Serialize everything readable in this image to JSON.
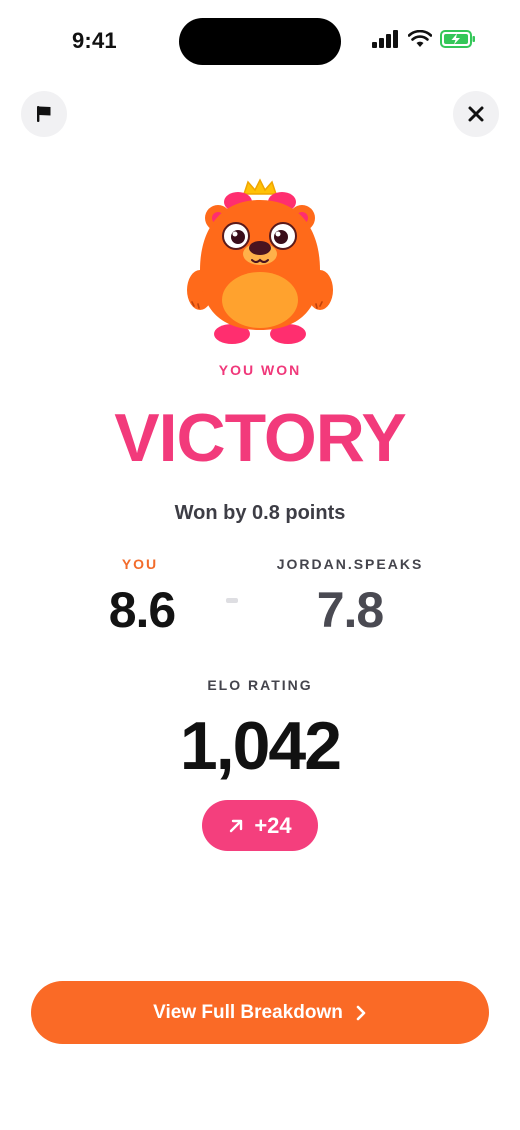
{
  "status_bar": {
    "time": "9:41",
    "icons": [
      "cellular-signal-icon",
      "wifi-icon",
      "battery-charging-icon"
    ],
    "battery_color": "#34c759"
  },
  "header": {
    "left_icon": "flag-icon",
    "right_icon": "close-icon"
  },
  "result": {
    "eyebrow": "YOU WON",
    "headline": "VICTORY",
    "margin_text": "Won by 0.8 points"
  },
  "scores": {
    "you_label": "YOU",
    "you_score": "8.6",
    "opponent_label": "JORDAN.SPEAKS",
    "opponent_score": "7.8"
  },
  "elo": {
    "label": "ELO RATING",
    "value": "1,042",
    "change": "+24",
    "change_icon": "arrow-up-right-icon"
  },
  "cta": {
    "label": "View Full Breakdown",
    "icon": "chevron-right-icon"
  },
  "colors": {
    "accent_pink": "#f23a7b",
    "accent_orange": "#fa6a26",
    "you_label": "#f26b2a"
  }
}
